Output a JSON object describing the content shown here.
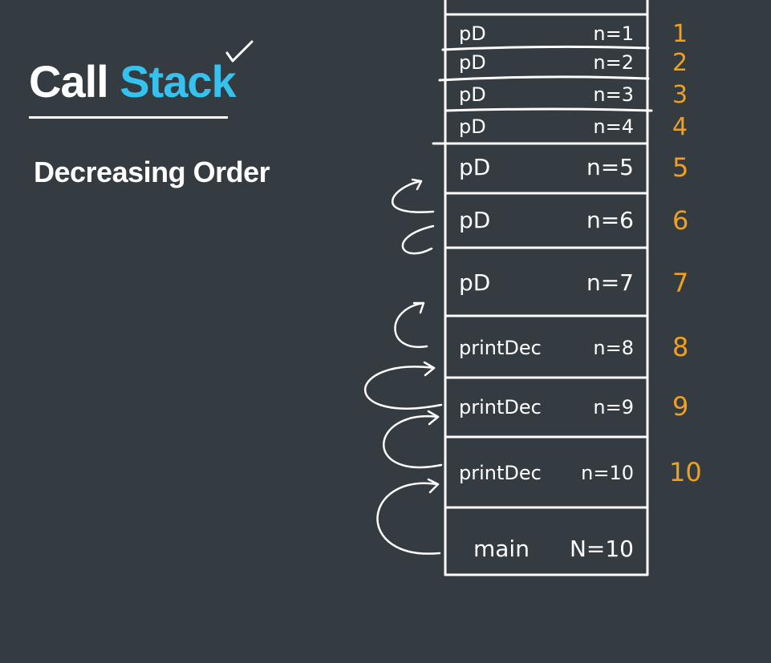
{
  "heading": {
    "word1": "Call",
    "word2": "Stack"
  },
  "subheading": "Decreasing Order",
  "colors": {
    "accent": "#35c2ee",
    "ink": "#ffffff",
    "index": "#f0a020",
    "background": "#343b41"
  },
  "frames": [
    {
      "fn": "pD",
      "arg": "n=1",
      "index": "1"
    },
    {
      "fn": "pD",
      "arg": "n=2",
      "index": "2"
    },
    {
      "fn": "pD",
      "arg": "n=3",
      "index": "3"
    },
    {
      "fn": "pD",
      "arg": "n=4",
      "index": "4"
    },
    {
      "fn": "pD",
      "arg": "n=5",
      "index": "5"
    },
    {
      "fn": "pD",
      "arg": "n=6",
      "index": "6"
    },
    {
      "fn": "pD",
      "arg": "n=7",
      "index": "7"
    },
    {
      "fn": "printDec",
      "arg": "n=8",
      "index": "8"
    },
    {
      "fn": "printDec",
      "arg": "n=9",
      "index": "9"
    },
    {
      "fn": "printDec",
      "arg": "n=10",
      "index": "10"
    },
    {
      "fn": "main",
      "arg": "N=10",
      "index": ""
    }
  ]
}
